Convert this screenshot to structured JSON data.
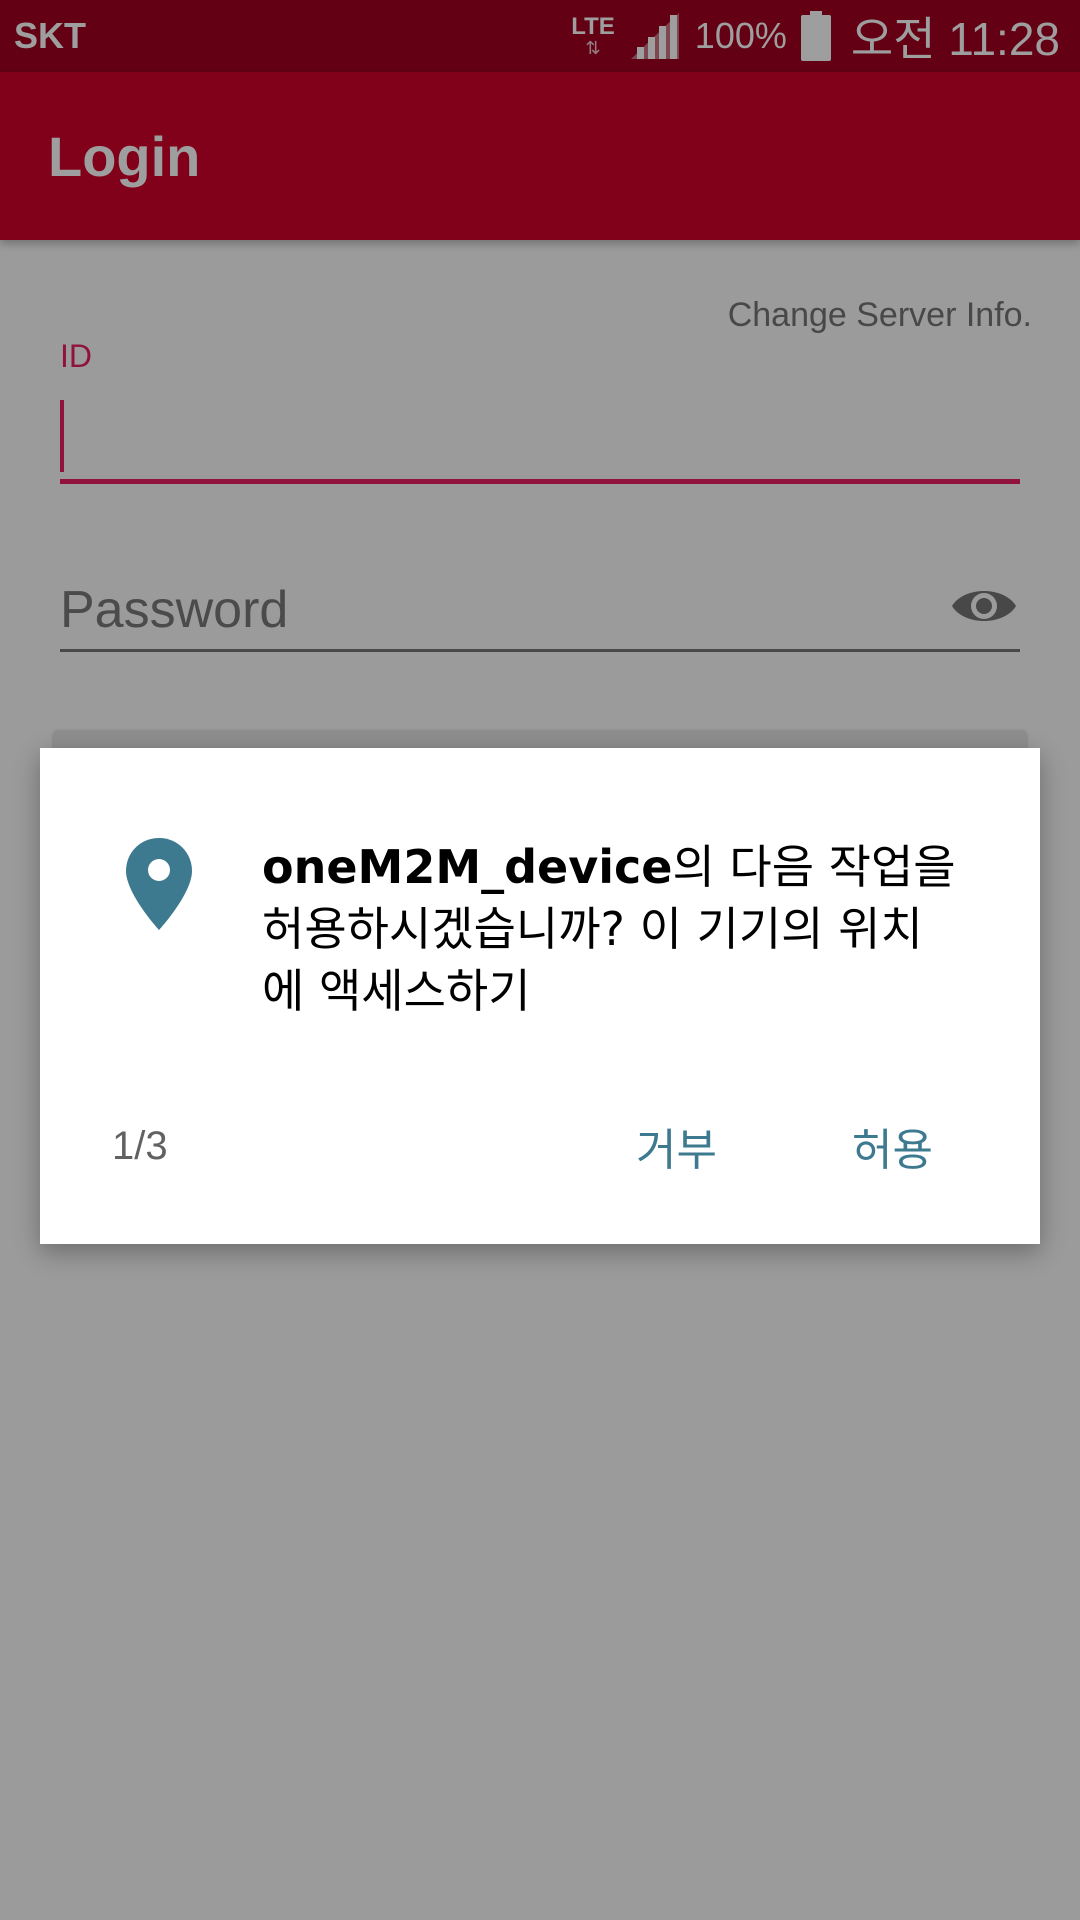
{
  "status_bar": {
    "carrier": "SKT",
    "network": "LTE",
    "battery": "100%",
    "time": "오전 11:28"
  },
  "app_bar": {
    "title": "Login"
  },
  "form": {
    "change_server": "Change Server Info.",
    "id_label": "ID",
    "id_value": "",
    "password_placeholder": "Password"
  },
  "dialog": {
    "app_name": "oneM2M_device",
    "message": "의 다음 작업을 허용하시겠습니까? 이 기기의 위치에 액세스하기",
    "page": "1/3",
    "deny_label": "거부",
    "allow_label": "허용"
  },
  "colors": {
    "status_bar": "#a00020",
    "app_bar": "#d0002a",
    "accent": "#e91e63",
    "dialog_button": "#3d7a8f",
    "location_icon": "#3d7a8f"
  },
  "icons": {
    "signal": "signal-icon",
    "battery": "battery-icon",
    "password_toggle": "eye-icon",
    "permission": "location-icon"
  }
}
